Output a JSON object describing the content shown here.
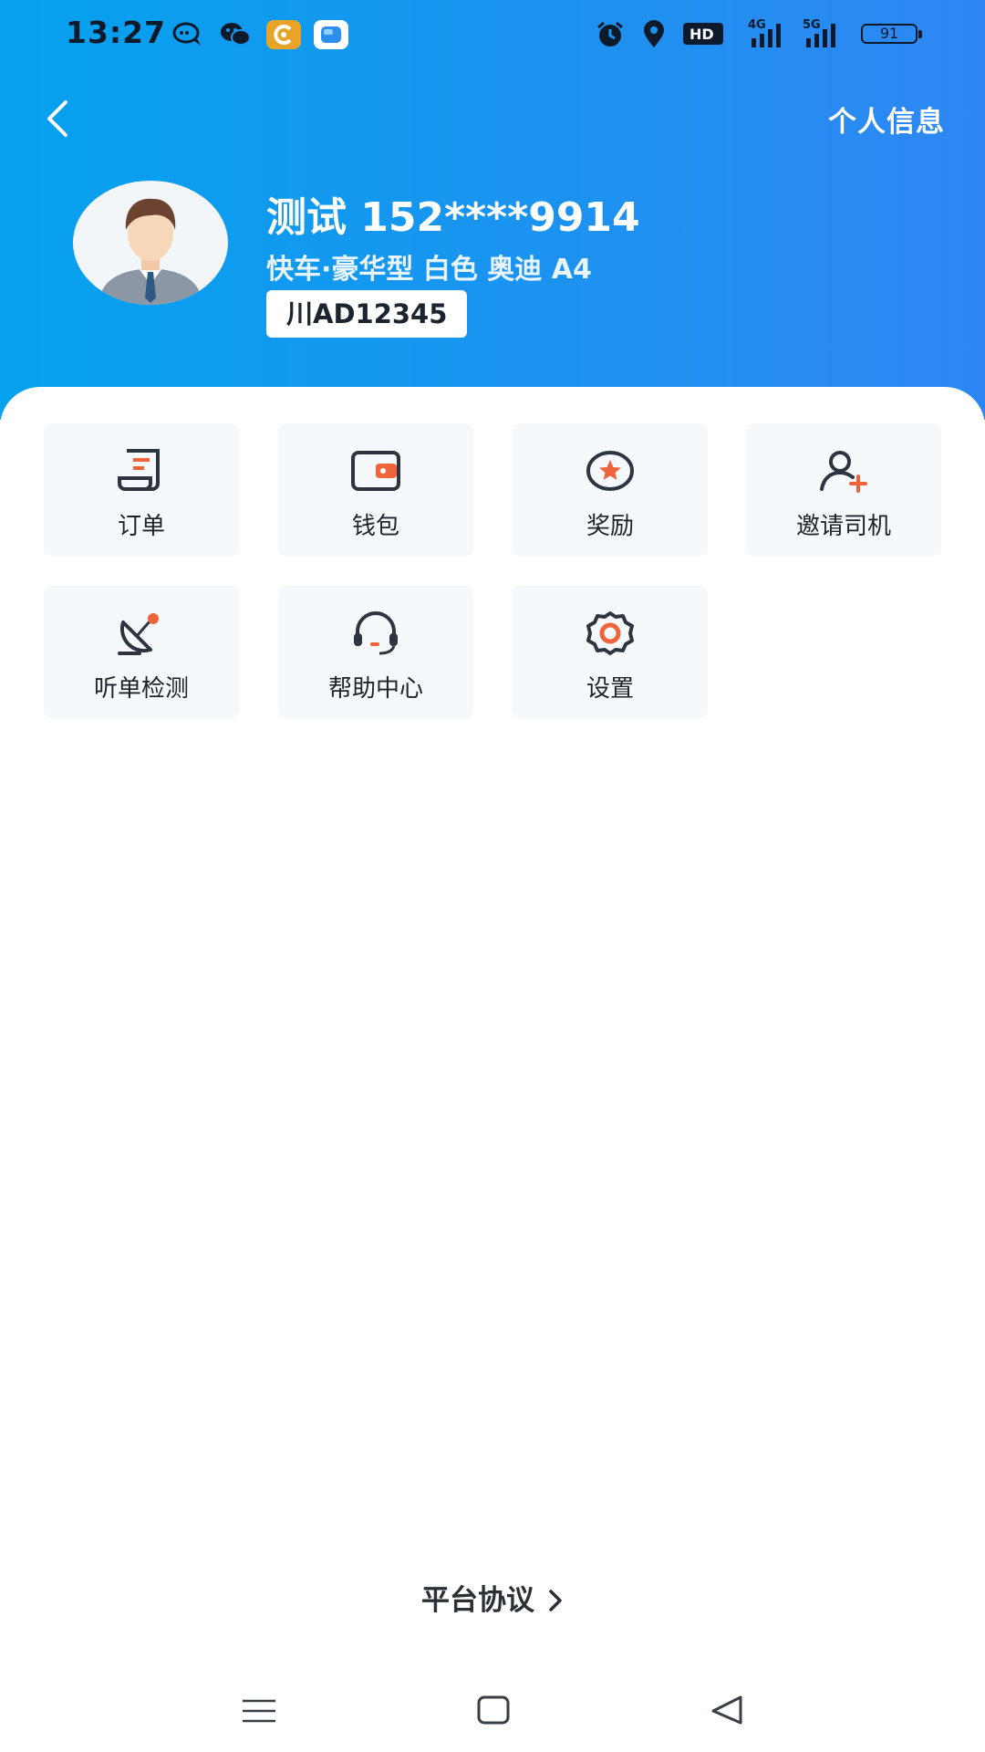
{
  "status_bar": {
    "time": "13:27",
    "hd_label": "HD",
    "network_1": "4G",
    "network_2": "5G",
    "battery": "91"
  },
  "header": {
    "profile_link": "个人信息",
    "driver_name": "测试 152****9914",
    "vehicle_info": "快车·豪华型 白色 奥迪 A4",
    "plate": "川AD12345"
  },
  "menu": {
    "items": [
      {
        "label": "订单",
        "icon": "order-icon"
      },
      {
        "label": "钱包",
        "icon": "wallet-icon"
      },
      {
        "label": "奖励",
        "icon": "reward-icon"
      },
      {
        "label": "邀请司机",
        "icon": "invite-driver-icon"
      },
      {
        "label": "听单检测",
        "icon": "listen-check-icon"
      },
      {
        "label": "帮助中心",
        "icon": "help-center-icon"
      },
      {
        "label": "设置",
        "icon": "settings-icon"
      }
    ]
  },
  "footer": {
    "agreement": "平台协议"
  },
  "colors": {
    "header_gradient_start": "#05a2ee",
    "header_gradient_end": "#2f86f2",
    "icon_dark": "#2d3540",
    "icon_accent": "#f0643c"
  }
}
